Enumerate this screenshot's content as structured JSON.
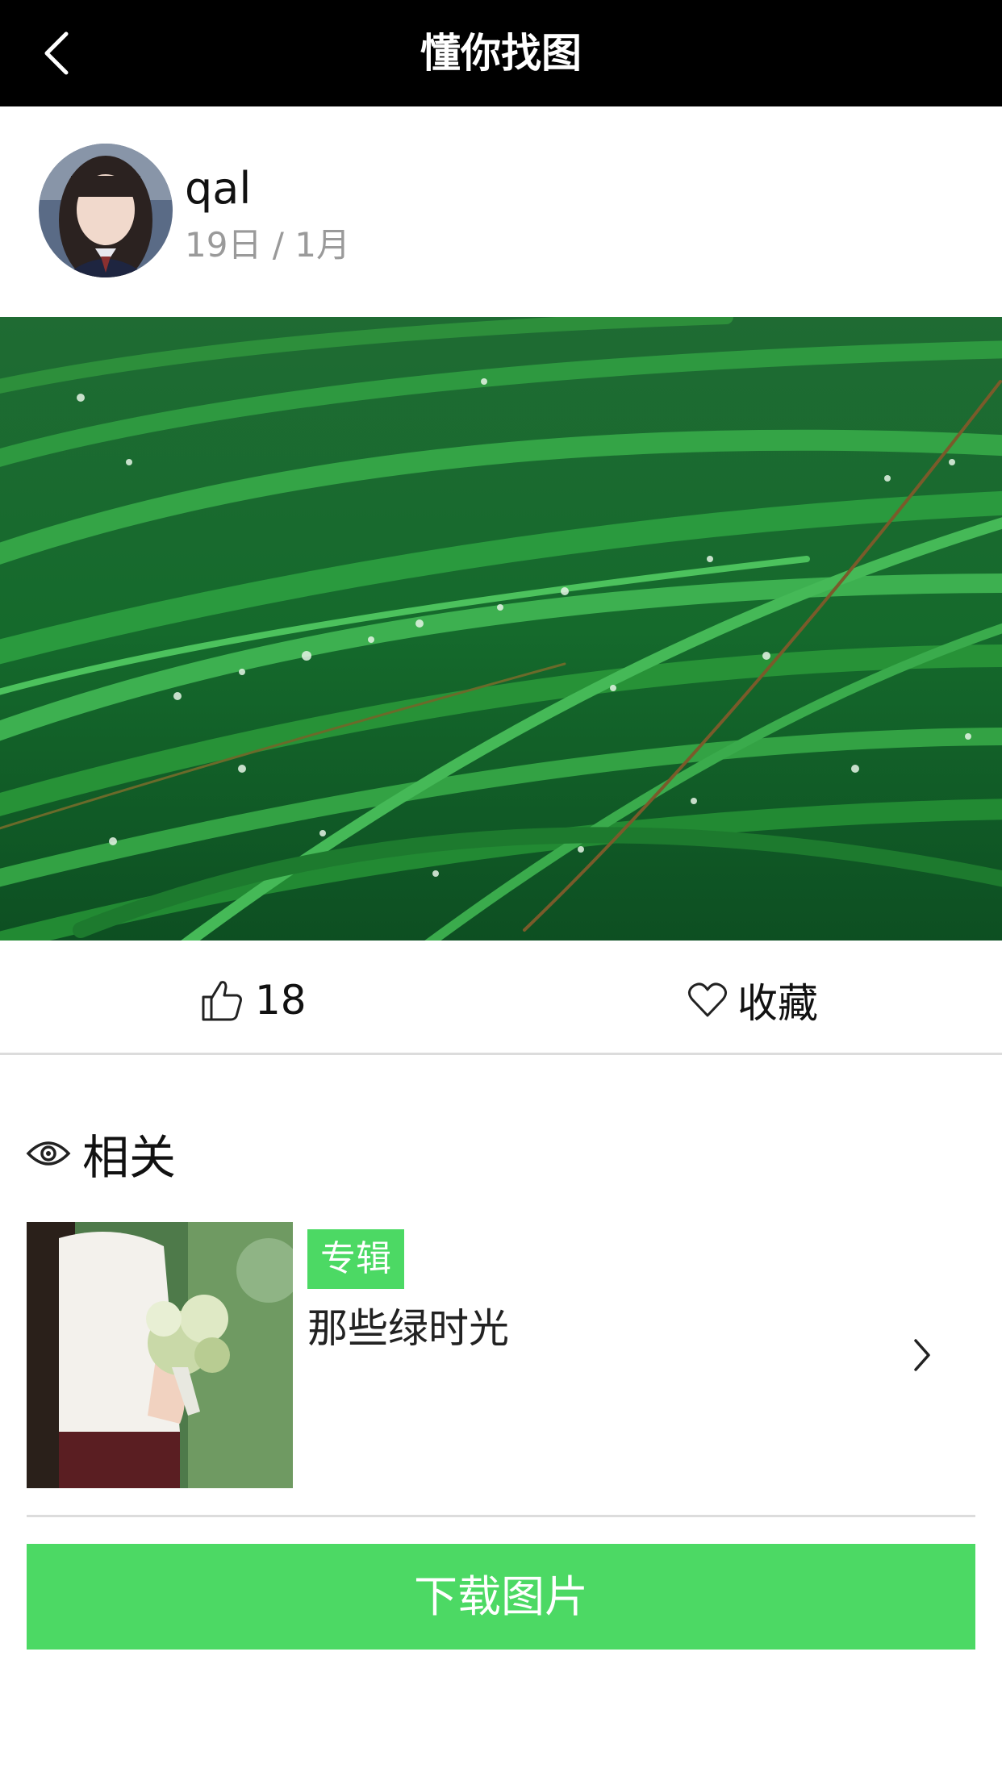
{
  "header": {
    "title": "懂你找图",
    "back_icon": "chevron-left-icon"
  },
  "user": {
    "name": "qal",
    "date": "19日 / 1月"
  },
  "actions": {
    "like_count": "18",
    "like_icon": "thumbs-up-icon",
    "favorite_label": "收藏",
    "favorite_icon": "heart-icon"
  },
  "related": {
    "heading": "相关",
    "heading_icon": "eye-icon",
    "album": {
      "tag": "专辑",
      "title": "那些绿时光",
      "arrow_icon": "chevron-right-icon"
    }
  },
  "download": {
    "label": "下载图片"
  },
  "colors": {
    "header_bg": "#000000",
    "accent_green": "#4cd964",
    "muted_text": "#9a9a9a"
  }
}
